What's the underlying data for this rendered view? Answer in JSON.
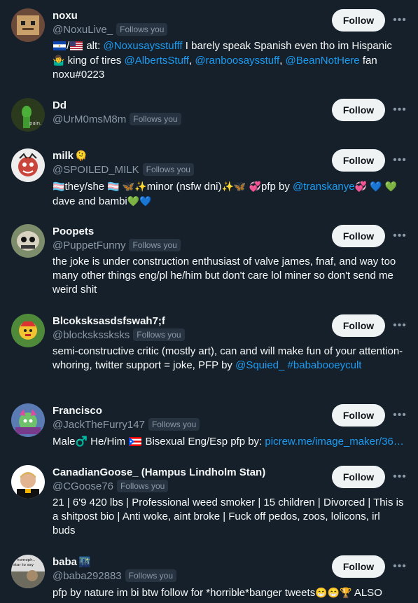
{
  "follow_label": "Follow",
  "follows_you_label": "Follows you",
  "more_icon": "•••",
  "users": [
    {
      "name": "noxu",
      "handle": "@NoxuLive_",
      "bio": [
        {
          "t": "flag",
          "v": "sv"
        },
        {
          "t": "text",
          "v": "/"
        },
        {
          "t": "flag",
          "v": "us"
        },
        {
          "t": "text",
          "v": " alt: "
        },
        {
          "t": "link",
          "v": "@Noxusaysstufff"
        },
        {
          "t": "text",
          "v": " I barely speak Spanish even tho im Hispanic "
        },
        {
          "t": "emoji",
          "v": "🤷‍♂️"
        },
        {
          "t": "text",
          "v": " king of tires "
        },
        {
          "t": "link",
          "v": "@AlbertsStuff"
        },
        {
          "t": "text",
          "v": ", "
        },
        {
          "t": "link",
          "v": "@ranboosaysstuff"
        },
        {
          "t": "text",
          "v": ", "
        },
        {
          "t": "link",
          "v": "@BeanNotHere"
        },
        {
          "t": "text",
          "v": " fan noxu#0223"
        }
      ]
    },
    {
      "name": "Dd",
      "handle": "@UrM0msM8m",
      "avatar_text": "pain.",
      "bio": []
    },
    {
      "name": "milk",
      "name_emoji": "🫠",
      "handle": "@SPOILED_MILK",
      "bio": [
        {
          "t": "emoji",
          "v": "🏳️‍⚧️"
        },
        {
          "t": "text",
          "v": "they/she "
        },
        {
          "t": "emoji",
          "v": "🏳️‍⚧️"
        },
        {
          "t": "text",
          "v": " "
        },
        {
          "t": "emoji",
          "v": "🦋✨"
        },
        {
          "t": "text",
          "v": "minor (nsfw dni)"
        },
        {
          "t": "emoji",
          "v": "✨🦋"
        },
        {
          "t": "text",
          "v": " "
        },
        {
          "t": "emoji",
          "v": "💞"
        },
        {
          "t": "text",
          "v": "pfp by "
        },
        {
          "t": "link",
          "v": "@transkanye"
        },
        {
          "t": "emoji",
          "v": "💞"
        },
        {
          "t": "text",
          "v": " "
        },
        {
          "t": "emoji",
          "v": "💙"
        },
        {
          "t": "text",
          "v": " "
        },
        {
          "t": "emoji",
          "v": "💚"
        },
        {
          "t": "text",
          "v": "dave and bambi"
        },
        {
          "t": "emoji",
          "v": "💚💙"
        }
      ]
    },
    {
      "name": "Poopets",
      "handle": "@PuppetFunny",
      "bio": [
        {
          "t": "text",
          "v": "the joke is under construction enthusiast of valve james, fnaf, and way too many other things eng/pl he/him but don't care lol miner so don't send me weird shit"
        }
      ]
    },
    {
      "name": "Blcoksksasdsfswah7;f",
      "handle": "@blockskssksks",
      "bio": [
        {
          "t": "text",
          "v": "semi-constructive critic (mostly art), can and will make fun of your attention-whoring, twitter support = joke, PFP by "
        },
        {
          "t": "link",
          "v": "@Squied_"
        },
        {
          "t": "text",
          "v": " "
        },
        {
          "t": "link",
          "v": "#bababooeycult"
        }
      ]
    },
    {
      "name": "Francisco",
      "handle": "@JackTheFurry147",
      "bio": [
        {
          "t": "text",
          "v": "Male"
        },
        {
          "t": "emoji",
          "v": "♂️"
        },
        {
          "t": "text",
          "v": " He/Him "
        },
        {
          "t": "flag",
          "v": "pr"
        },
        {
          "t": "text",
          "v": " Bisexual Eng/Esp pfp by: "
        },
        {
          "t": "link",
          "v": "picrew.me/image_maker/36…"
        }
      ]
    },
    {
      "name": "CanadianGoose_ (Hampus Lindholm Stan)",
      "handle": "@CGoose76",
      "bio": [
        {
          "t": "text",
          "v": "21 | 6'9 420 lbs | Professional weed smoker | 15 children | Divorced | This is a shitpost bio | Anti woke, aint broke | Fuck off pedos, zoos, lolicons, irl buds"
        }
      ]
    },
    {
      "name": "baba",
      "name_emoji": "🌃",
      "handle": "@baba292883",
      "avatar_text": "a homoph.. star to say",
      "bio": [
        {
          "t": "text",
          "v": "pfp by nature im bi btw follow for *horrible*banger tweets"
        },
        {
          "t": "emoji",
          "v": "😁😁🏆"
        },
        {
          "t": "text",
          "v": " ALSO"
        }
      ]
    }
  ],
  "colors": {
    "background": "#15202b",
    "link": "#1d9bf0",
    "secondary_text": "#8b98a5",
    "button_bg": "#eff3f4"
  }
}
